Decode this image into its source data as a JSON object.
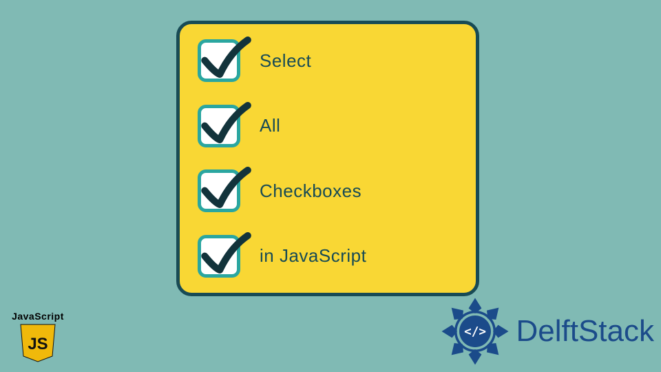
{
  "card": {
    "items": [
      {
        "label": "Select"
      },
      {
        "label": "All"
      },
      {
        "label": "Checkboxes"
      },
      {
        "label": "in JavaScript"
      }
    ]
  },
  "js_badge": {
    "label": "JavaScript",
    "shield_text": "JS"
  },
  "brand": {
    "name": "DelftStack",
    "emblem_text": "</>"
  },
  "colors": {
    "background": "#80bab4",
    "card_bg": "#f9d734",
    "card_border": "#184b55",
    "checkbox_border": "#2aa6a0",
    "check_stroke": "#12333b",
    "brand_text": "#1b4b8a",
    "shield": "#f0b90b"
  }
}
